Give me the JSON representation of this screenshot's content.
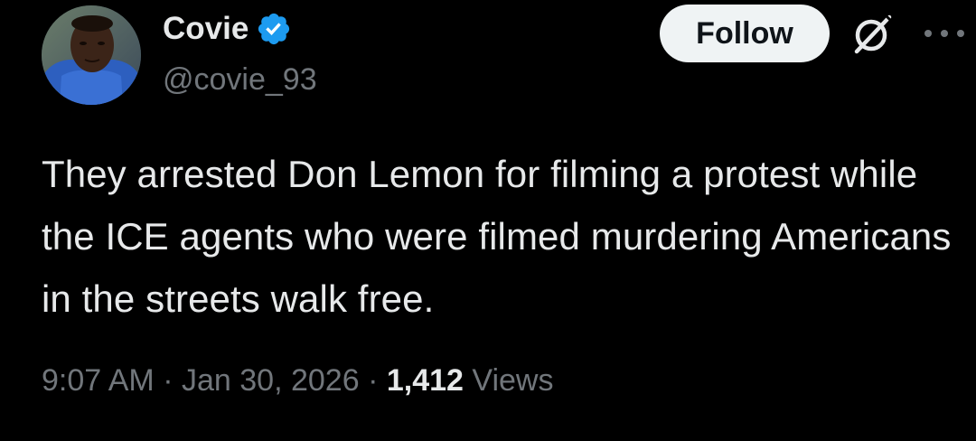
{
  "author": {
    "display_name": "Covie",
    "handle": "@covie_93",
    "verified": true,
    "avatar_icon": "profile-photo"
  },
  "actions": {
    "follow_label": "Follow",
    "grok_icon": "grok-icon",
    "more_icon": "more-icon"
  },
  "tweet": {
    "text": "They arrested Don Lemon for filming a protest while the ICE agents who were filmed murdering Americans in the streets walk free."
  },
  "meta": {
    "time": "9:07 AM",
    "separator": "·",
    "date": "Jan 30, 2026",
    "views_count": "1,412",
    "views_label": "Views"
  },
  "colors": {
    "background": "#000000",
    "text_primary": "#e7e9ea",
    "text_secondary": "#71767b",
    "verified_blue": "#1d9bf0",
    "follow_bg": "#eff3f4"
  }
}
